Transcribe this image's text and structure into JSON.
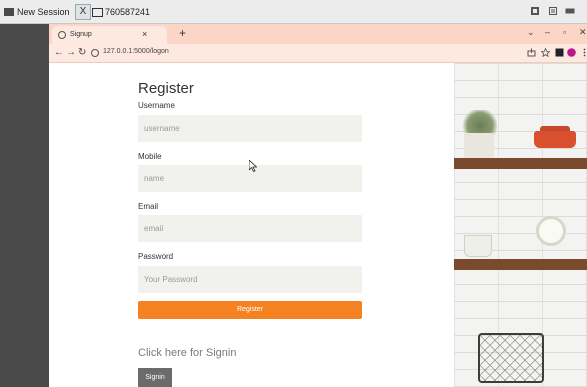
{
  "session": {
    "title": "New Session",
    "id_label": "760587241",
    "close_label": "X"
  },
  "browser": {
    "tab_title": "Signup",
    "tab_close": "×",
    "new_tab": "+",
    "url": "127.0.0.1:5000/logon",
    "win_controls": [
      "⌄",
      "–",
      "▫",
      "✕"
    ]
  },
  "form": {
    "title": "Register",
    "username": {
      "label": "Username",
      "placeholder": "username"
    },
    "mobile": {
      "label": "Mobile",
      "placeholder": "name"
    },
    "email": {
      "label": "Email",
      "placeholder": "email"
    },
    "password": {
      "label": "Password",
      "placeholder": "Your Password"
    },
    "register_button": "Register",
    "signin_text": "Click here for Signin",
    "signin_button": "Signin"
  },
  "colors": {
    "accent": "#f58220",
    "tabstrip": "#fbd5c6"
  }
}
